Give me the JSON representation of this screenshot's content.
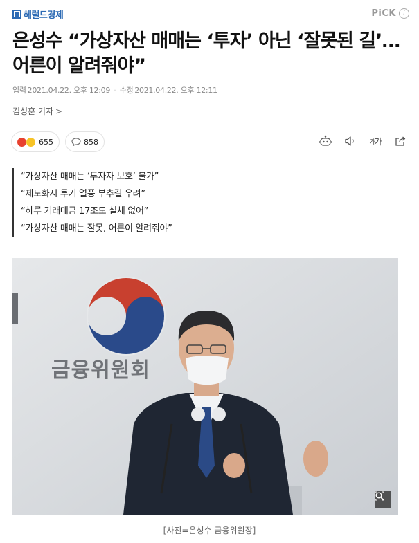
{
  "header": {
    "logo_text": "헤럴드경제",
    "pick_label": "PiCK",
    "info_icon": "i"
  },
  "article": {
    "title": "은성수 “가상자산 매매는 ‘투자’ 아닌 ‘잘못된 길’… 어른이 알려줘야”",
    "date_input_label": "입력",
    "date_input": "2021.04.22. 오후 12:09",
    "date_update_label": "수정",
    "date_update": "2021.04.22. 오후 12:11",
    "reporter": "김성훈 기자",
    "reporter_chevron": ">"
  },
  "reactions": {
    "emotion_count": "655",
    "comment_count": "858"
  },
  "toolbar": {
    "fontsize_label_small": "가",
    "fontsize_label": "가",
    "icons": [
      "robot-summary-icon",
      "speaker-icon",
      "font-size-icon",
      "share-icon"
    ]
  },
  "summary": {
    "lines": [
      "“가상자산 매매는 ‘투자자 보호’ 불가”",
      "“제도화시 투기 열풍 부추길 우려”",
      "“하루 거래대금 17조도 실체 없어”",
      "“가상자산 매매는 잘못, 어른이 알려줘야”"
    ]
  },
  "photo": {
    "wall_text": "금융위원회",
    "caption": "[사진=은성수 금융위원장]"
  },
  "colors": {
    "brand_blue": "#2c6ab4",
    "emblem_red": "#c8402f",
    "emblem_blue": "#2a4a8a"
  }
}
